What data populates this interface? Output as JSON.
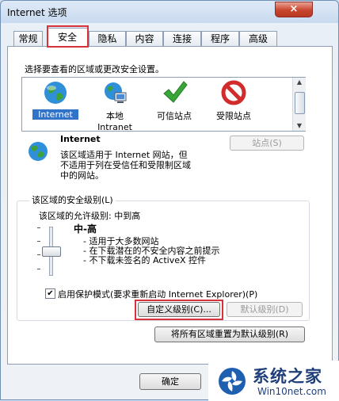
{
  "window": {
    "title": "Internet 选项",
    "close_glyph": "×"
  },
  "tabs": [
    {
      "label": "常规"
    },
    {
      "label": "安全"
    },
    {
      "label": "隐私"
    },
    {
      "label": "内容"
    },
    {
      "label": "连接"
    },
    {
      "label": "程序"
    },
    {
      "label": "高级"
    }
  ],
  "security": {
    "prompt": "选择要查看的区域或更改安全设置。",
    "zones": [
      {
        "label": "Internet",
        "icon": "globe-icon",
        "selected": true
      },
      {
        "label1": "本地",
        "label2": "Intranet",
        "icon": "local-intranet-icon"
      },
      {
        "label": "可信站点",
        "icon": "checkmark-icon"
      },
      {
        "label": "受限站点",
        "icon": "no-entry-icon"
      }
    ],
    "zone_name": "Internet",
    "zone_desc": [
      "该区域适用于 Internet 网站，但",
      "不适用于列在受信任和受限制区域",
      "中的网站。"
    ],
    "sites_button": "站点(S)",
    "level_group": "该区域的安全级别(L)",
    "allowed_levels": "该区域的允许级别: 中到高",
    "level_name": "中-高",
    "level_bullets": [
      "- 适用于大多数网站",
      "- 在下载潜在的不安全内容之前提示",
      "- 不下载未签名的 ActiveX 控件"
    ],
    "protected_mode": "启用保护模式(要求重新启动 Internet Explorer)(P)",
    "protected_mode_checked": true,
    "custom_level_button": "自定义级别(C)...",
    "default_level_button": "默认级别(D)",
    "reset_all_button": "将所有区域重置为默认级别(R)"
  },
  "footer": {
    "ok_button": "确定"
  },
  "watermark": {
    "brand": "系统之家",
    "url": "Win10net.com"
  },
  "colors": {
    "accent_red": "#d8323a",
    "selection_blue": "#3173c9"
  }
}
